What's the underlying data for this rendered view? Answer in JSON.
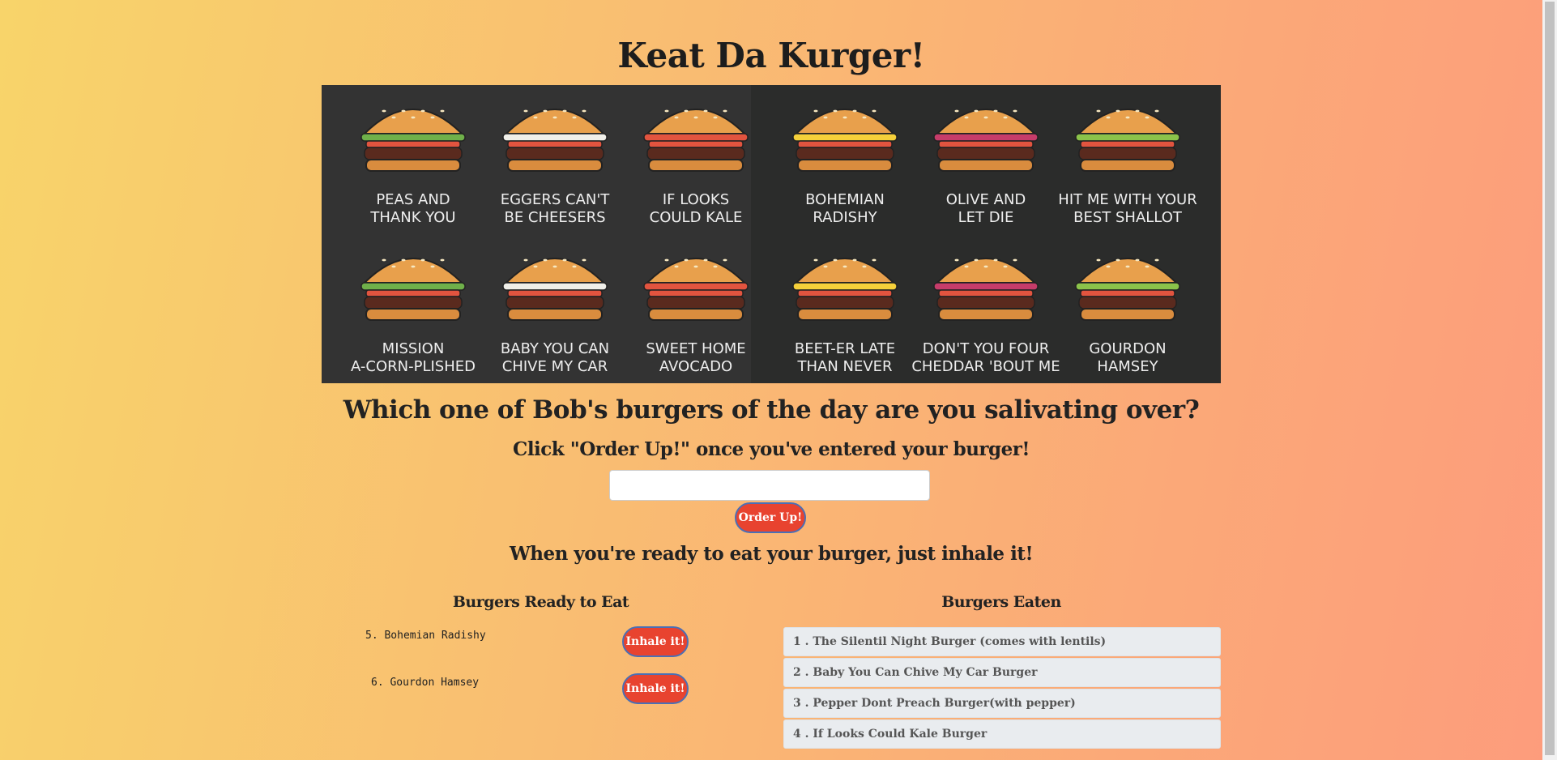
{
  "page": {
    "title": "Keat Da Kurger!",
    "question": "Which one of Bob's burgers of the day are you salivating over?",
    "instructions": "Click \"Order Up!\" once you've entered your burger!",
    "input_value": "",
    "order_button": "Order Up!",
    "ready_message": "When you're ready to eat your burger, just inhale it!"
  },
  "banner": {
    "labels": [
      [
        "PEAS AND",
        "THANK YOU"
      ],
      [
        "EGGERS CAN'T",
        "BE CHEESERS"
      ],
      [
        "IF LOOKS",
        "COULD KALE"
      ],
      [
        "BOHEMIAN",
        "RADISHY"
      ],
      [
        "OLIVE AND",
        "LET DIE"
      ],
      [
        "HIT ME WITH YOUR",
        "BEST SHALLOT"
      ],
      [
        "MISSION",
        "A-CORN-PLISHED"
      ],
      [
        "BABY YOU CAN",
        "CHIVE MY CAR"
      ],
      [
        "SWEET HOME",
        "AVOCADO"
      ],
      [
        "BEET-ER LATE",
        "THAN NEVER"
      ],
      [
        "DON'T YOU FOUR",
        "CHEDDAR 'BOUT ME"
      ],
      [
        "GOURDON",
        "HAMSEY"
      ]
    ]
  },
  "ready": {
    "heading": "Burgers Ready to Eat",
    "items": [
      {
        "label": "5. Bohemian Radishy",
        "button": "Inhale it!"
      },
      {
        "label": "6. Gourdon Hamsey",
        "button": "Inhale it!"
      }
    ]
  },
  "eaten": {
    "heading": "Burgers Eaten",
    "items": [
      "1 . The Silentil Night Burger (comes with lentils)",
      "2 . Baby You Can Chive My Car Burger",
      "3 . Pepper Dont Preach Burger(with pepper)",
      "4 . If Looks Could Kale Burger"
    ]
  },
  "colors": {
    "button_red": "#e8432f",
    "button_border": "#4a6fb5",
    "eaten_bg": "#e9ecef"
  }
}
